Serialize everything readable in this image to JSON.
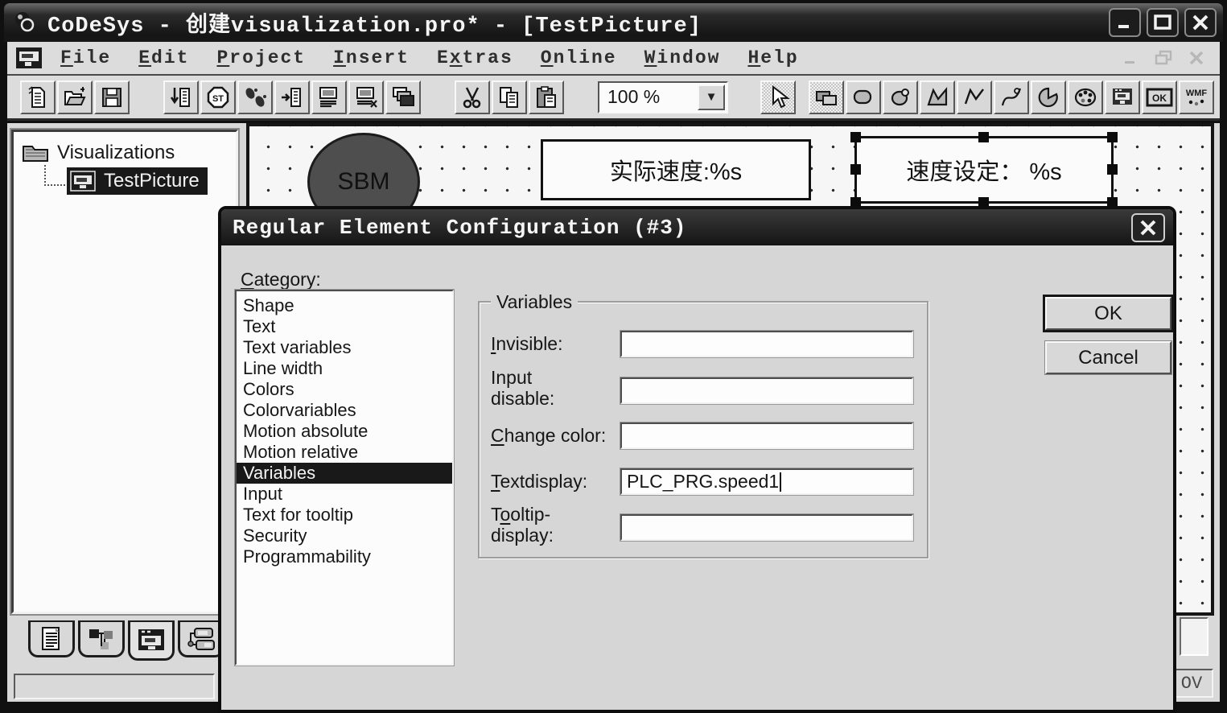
{
  "window": {
    "title": "CoDeSys - 创建visualization.pro* - [TestPicture]",
    "control_icons": [
      "minimize-icon",
      "maximize-icon",
      "close-icon"
    ]
  },
  "menu": {
    "items": [
      {
        "pre": "",
        "key": "F",
        "post": "ile"
      },
      {
        "pre": "",
        "key": "E",
        "post": "dit"
      },
      {
        "pre": "",
        "key": "P",
        "post": "roject"
      },
      {
        "pre": "",
        "key": "I",
        "post": "nsert"
      },
      {
        "pre": "E",
        "key": "x",
        "post": "tras"
      },
      {
        "pre": "",
        "key": "O",
        "post": "nline"
      },
      {
        "pre": "",
        "key": "W",
        "post": "indow"
      },
      {
        "pre": "",
        "key": "H",
        "post": "elp"
      }
    ],
    "mdi_control_icons": [
      "minimize-icon",
      "restore-icon",
      "close-icon"
    ]
  },
  "toolbar": {
    "zoom_value": "100 %",
    "icons": [
      "new-file-icon",
      "open-folder-icon",
      "save-icon",
      "download-icon",
      "stop-st-icon",
      "run-trace-icon",
      "step-icon",
      "login-icon",
      "logout-icon",
      "library-icon",
      "cut-icon",
      "copy-icon",
      "paste-icon",
      "select-cursor-icon",
      "rectangle-tool-icon",
      "rounded-rect-tool-icon",
      "ellipse-tool-icon",
      "polygon-tool-icon",
      "polyline-tool-icon",
      "curve-tool-icon",
      "pie-tool-icon",
      "bitmap-tool-icon",
      "visualization-tool-icon",
      "button-tool-icon",
      "wmf-tool-icon"
    ],
    "ok_tool_text": "OK",
    "wmf_tool_text": "WMF"
  },
  "tree": {
    "root": "Visualizations",
    "child": "TestPicture"
  },
  "canvas": {
    "ellipse_label": "SBM",
    "text_element_1": "实际速度:%s",
    "text_element_2": "速度设定： %s"
  },
  "object_tabs": {
    "icons": [
      "pou-document-icon",
      "data-types-icon",
      "visualizations-icon",
      "resources-icon"
    ],
    "active": "visualizations"
  },
  "statusbar": {
    "right_indicator": "OV"
  },
  "dialog": {
    "title": "Regular Element Configuration (#3)",
    "close_icon": "close-icon",
    "category_label": {
      "pre": "",
      "key": "C",
      "post": "ategory:"
    },
    "categories": [
      "Shape",
      "Text",
      "Text variables",
      "Line width",
      "Colors",
      "Colorvariables",
      "Motion absolute",
      "Motion relative",
      "Variables",
      "Input",
      "Text for tooltip",
      "Security",
      "Programmability"
    ],
    "selected_category": "Variables",
    "group_label": "Variables",
    "fields": {
      "invisible": {
        "label": {
          "pre": "",
          "key": "I",
          "post": "nvisible:"
        },
        "value": ""
      },
      "input_disable": {
        "line1": "Input",
        "line2": "disable:",
        "value": ""
      },
      "change_color": {
        "label": {
          "pre": "",
          "key": "C",
          "post": "hange color:"
        },
        "value": ""
      },
      "textdisplay": {
        "label": {
          "pre": "",
          "key": "T",
          "post": "extdisplay:"
        },
        "value": "PLC_PRG.speed1"
      },
      "tooltip_display": {
        "line1": {
          "pre": "T",
          "key": "o",
          "post": "oltip-"
        },
        "line2": "display:",
        "value": ""
      }
    },
    "buttons": {
      "ok": "OK",
      "cancel": "Cancel"
    }
  },
  "colors": {
    "titlebar_bg": "#1f1f1f",
    "chrome_bg": "#dcdcdc",
    "selection_bg": "#191919",
    "canvas_bg": "#f6f6f6",
    "ellipse_fill": "#4e4e4e"
  }
}
